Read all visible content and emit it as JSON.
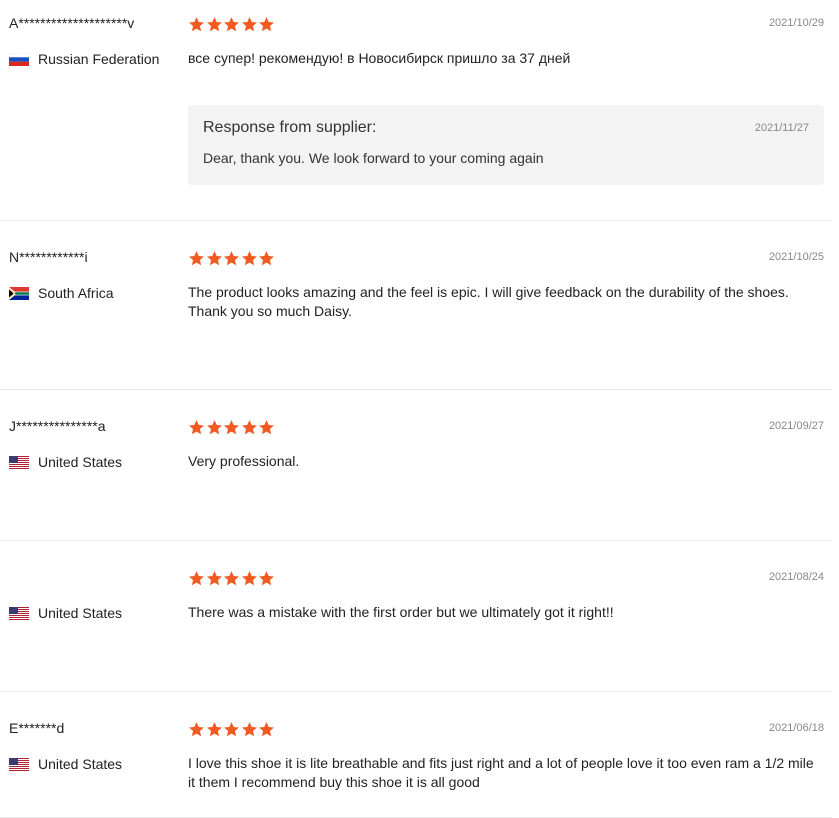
{
  "reviews": [
    {
      "buyer": "A********************v",
      "country": "Russian Federation",
      "flag": "ru",
      "rating": 5,
      "date": "2021/10/29",
      "text": "все супер! рекомендую! в Новосибирск пришло за 37 дней",
      "response": {
        "title": "Response from supplier:",
        "date": "2021/11/27",
        "text": "Dear, thank you. We look forward to your coming again"
      }
    },
    {
      "buyer": "N************i",
      "country": "South Africa",
      "flag": "za",
      "rating": 5,
      "date": "2021/10/25",
      "text": "The product looks amazing and the feel is epic. I will give feedback on the durability of the shoes. Thank you so much Daisy."
    },
    {
      "buyer": "J***************a",
      "country": "United States",
      "flag": "us",
      "rating": 5,
      "date": "2021/09/27",
      "text": "Very professional."
    },
    {
      "buyer": "",
      "country": "United States",
      "flag": "us",
      "rating": 5,
      "date": "2021/08/24",
      "text": "There was a mistake with the first order but we ultimately got it right!!"
    },
    {
      "buyer": "E*******d",
      "country": "United States",
      "flag": "us",
      "rating": 5,
      "date": "2021/06/18",
      "text": "I love this shoe it is lite breathable and fits just right and a lot of people love it too even ram a 1/2 mile it them I recommend buy this shoe it is all good"
    }
  ],
  "colors": {
    "star": "#f15a22",
    "divider": "#e8e8e8",
    "response_bg": "#f3f3f3"
  }
}
